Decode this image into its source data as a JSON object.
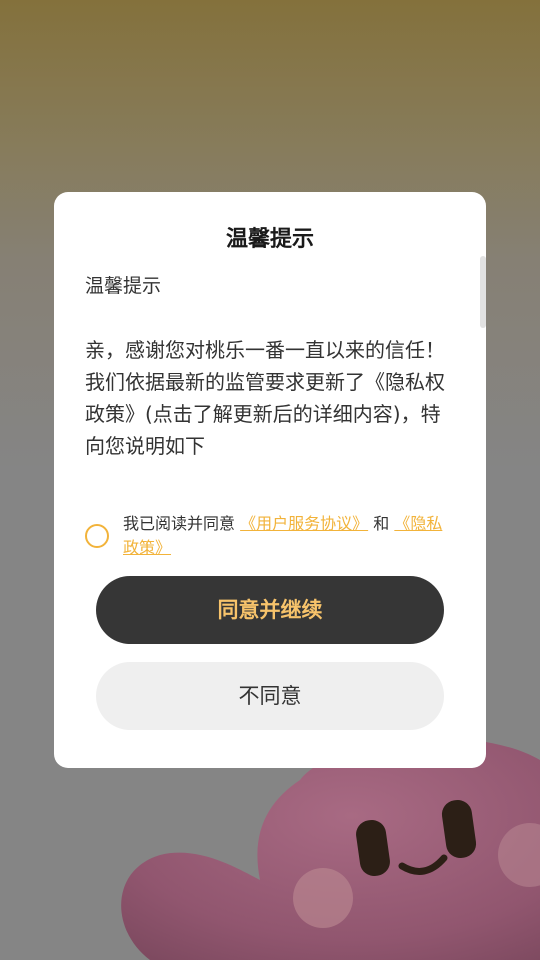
{
  "dialog": {
    "title": "温馨提示",
    "sub_heading": "温馨提示",
    "body": "亲，感谢您对桃乐一番一直以来的信任！我们依据最新的监管要求更新了《隐私权政策》(点击了解更新后的详细内容)，特向您说明如下",
    "agreement": {
      "prefix": "我已阅读并同意",
      "user_agreement_link": "《用户服务协议》",
      "conjunction": "和",
      "privacy_policy_link": "《隐私政策》",
      "checked": false
    },
    "agree_button_label": "同意并继续",
    "disagree_button_label": "不同意"
  },
  "colors": {
    "accent": "#f2b33a",
    "primary_button_bg": "#363636",
    "primary_button_text": "#f7c36b",
    "secondary_button_bg": "#efefef",
    "mascot": "#9a5a73"
  },
  "icons": {
    "mascot": "pink-blob-mascot"
  }
}
